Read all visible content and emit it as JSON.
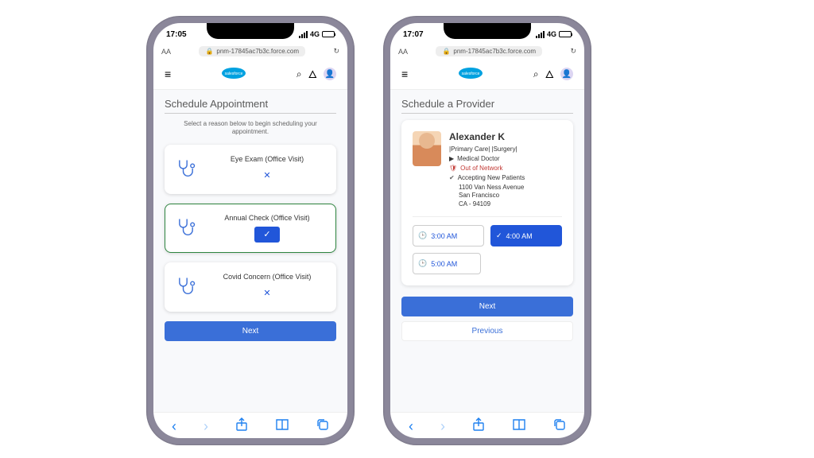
{
  "status": {
    "time_left": "17:05",
    "time_right": "17:07",
    "network": "4G"
  },
  "browser": {
    "aa": "AA",
    "url": "pnm-17845ac7b3c.force.com",
    "logo": "salesforce"
  },
  "left": {
    "title": "Schedule Appointment",
    "subtitle": "Select a reason below to begin scheduling your appointment.",
    "cards": [
      {
        "label": "Eye Exam (Office Visit)",
        "selected": false
      },
      {
        "label": "Annual Check (Office Visit)",
        "selected": true
      },
      {
        "label": "Covid Concern (Office Visit)",
        "selected": false
      }
    ],
    "next": "Next"
  },
  "right": {
    "title": "Schedule a Provider",
    "provider": {
      "name": "Alexander K",
      "specialties": "|Primary Care|  |Surgery|",
      "role": "Medical Doctor",
      "network": "Out of Network",
      "accepting": "Accepting New Patients",
      "address1": "1100 Van Ness Avenue",
      "address2": "San Francisco",
      "address3": "CA - 94109"
    },
    "slots": [
      {
        "label": "3:00 AM",
        "selected": false
      },
      {
        "label": "4:00 AM",
        "selected": true
      },
      {
        "label": "5:00 AM",
        "selected": false
      }
    ],
    "next": "Next",
    "prev": "Previous"
  }
}
